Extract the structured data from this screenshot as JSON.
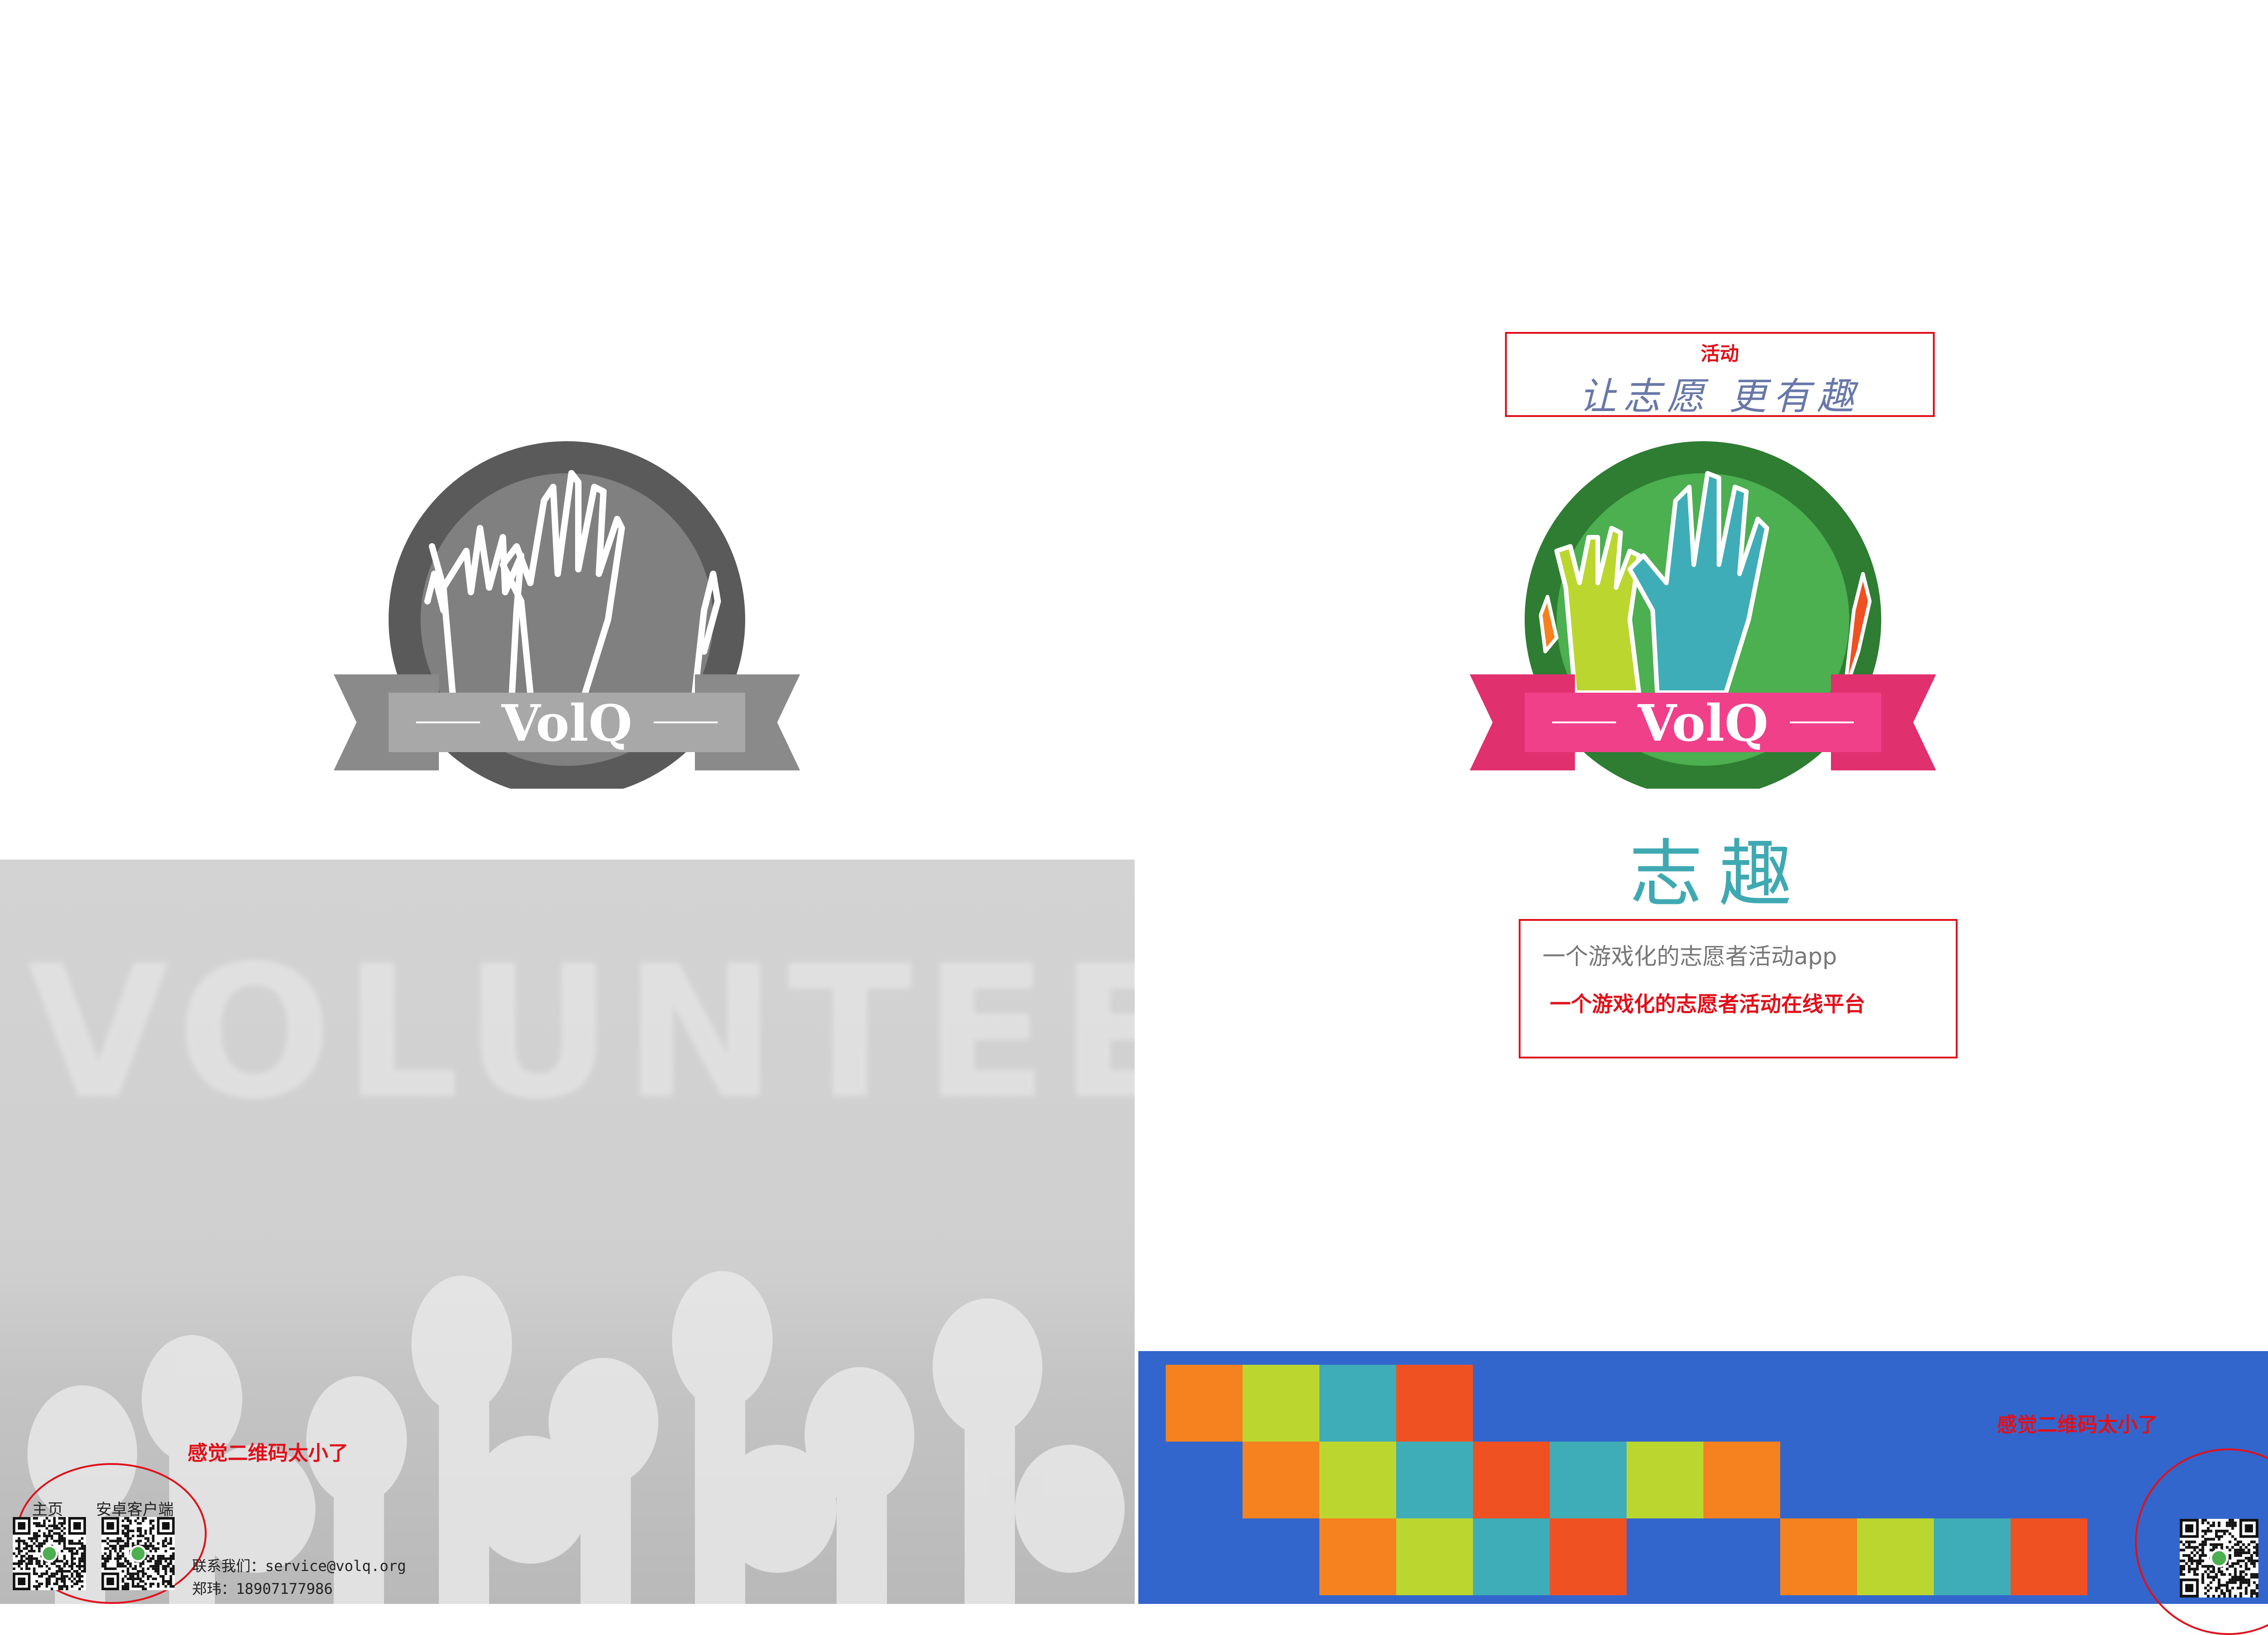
{
  "brand": {
    "logo_text": "VolQ",
    "name": "志趣"
  },
  "left_page": {
    "background_word": "VOLUNTEER",
    "note": "感觉二维码太小了",
    "qr_labels": {
      "home": "主页",
      "android": "安卓客户端"
    },
    "contact": {
      "email_line": "联系我们：service@volq.org",
      "phone_line": "郑玮：18907177986"
    }
  },
  "right_page": {
    "slogan_top": "活动",
    "slogan_main": "让志愿 更有趣",
    "tagline_1": "一个游戏化的志愿者活动app",
    "tagline_2": "一个游戏化的志愿者活动在线平台",
    "note": "感觉二维码太小了"
  },
  "colors": {
    "annotation_red": "#e0101a",
    "brand_teal": "#3fa9b2",
    "logo_green": "#2e7d32",
    "ribbon_pink": "#f0408a",
    "band_blue": "#3366cc",
    "tile_orange": "#f5811f",
    "tile_lime": "#bcd630",
    "tile_teal": "#3fadb7",
    "tile_red": "#ef5123"
  },
  "icons": [
    "volq-logo-gray",
    "volq-logo-color",
    "qr-code-icon",
    "raised-hands-photo"
  ]
}
